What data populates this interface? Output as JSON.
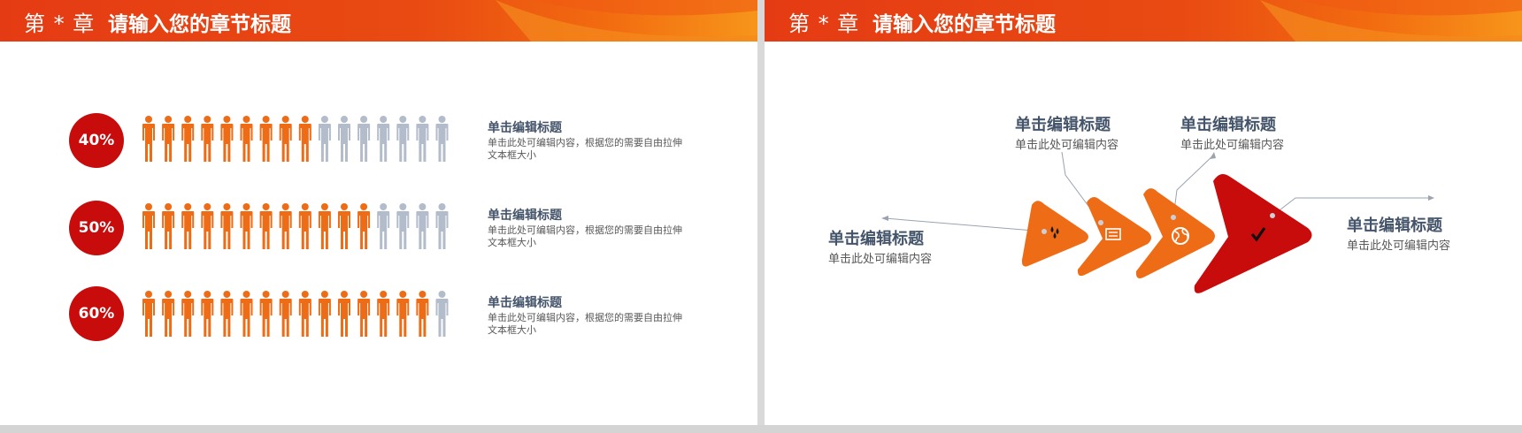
{
  "left_slide": {
    "header": {
      "chapter": "第 * 章",
      "title": "请输入您的章节标题"
    },
    "rows": [
      {
        "percent": "40%",
        "highlighted": 9,
        "total": 16,
        "title": "单击编辑标题",
        "body": "单击此处可编辑内容，根据您的需要自由拉伸文本框大小"
      },
      {
        "percent": "50%",
        "highlighted": 12,
        "total": 16,
        "title": "单击编辑标题",
        "body": "单击此处可编辑内容，根据您的需要自由拉伸文本框大小"
      },
      {
        "percent": "60%",
        "highlighted": 15,
        "total": 16,
        "title": "单击编辑标题",
        "body": "单击此处可编辑内容，根据您的需要自由拉伸文本框大小"
      }
    ]
  },
  "right_slide": {
    "header": {
      "chapter": "第 * 章",
      "title": "请输入您的章节标题"
    },
    "callouts": [
      {
        "title": "单击编辑标题",
        "sub": "单击此处可编辑内容"
      },
      {
        "title": "单击编辑标题",
        "sub": "单击此处可编辑内容"
      },
      {
        "title": "单击编辑标题",
        "sub": "单击此处可编辑内容"
      },
      {
        "title": "单击编辑标题",
        "sub": "单击此处可编辑内容"
      }
    ],
    "steps": [
      {
        "icon": "drops-icon"
      },
      {
        "icon": "newspaper-icon"
      },
      {
        "icon": "globe-icon"
      },
      {
        "icon": "checkmark-icon"
      }
    ]
  },
  "colors": {
    "accent": "#c80b0b",
    "orange": "#ef6c16",
    "person_gray": "#b3bccb",
    "text_dark": "#44546a"
  }
}
